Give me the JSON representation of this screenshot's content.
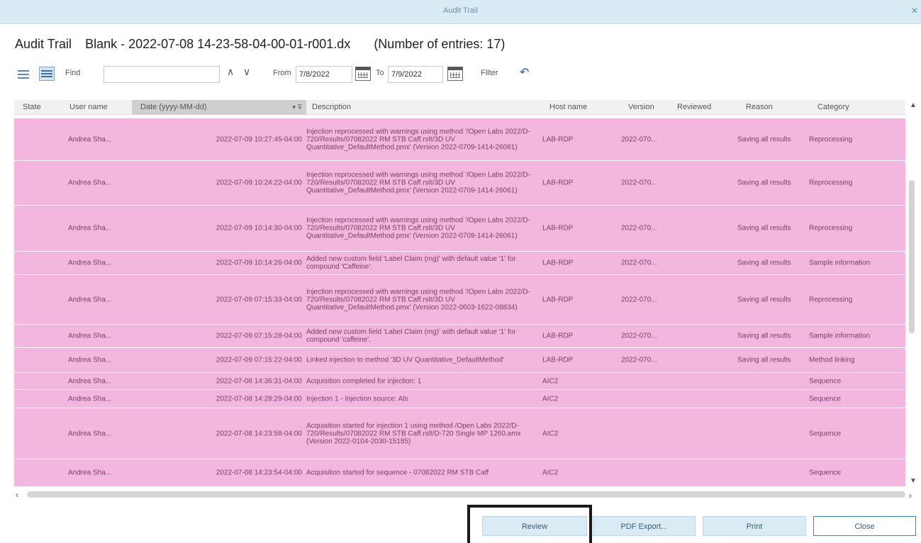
{
  "window": {
    "title": "Audit Trail",
    "close_icon": "close-icon"
  },
  "header": {
    "title": "Audit Trail",
    "filename": "Blank - 2022-07-08 14-23-58-04-00-01-r001.dx",
    "entries": "(Number of entries: 17)"
  },
  "toolbar": {
    "find_label": "Find",
    "find_value": "",
    "from_label": "From",
    "from_value": "7/8/2022",
    "to_label": "To",
    "to_value": "7/9/2022",
    "filter_label": "Filter"
  },
  "columns": [
    "State",
    "User name",
    "Date (yyyy-MM-dd)",
    "Description",
    "Host name",
    "Version",
    "Reviewed",
    "Reason",
    "Category"
  ],
  "rows": [
    {
      "user": "Andrea Sha...",
      "date": "2022-07-09 10:27:45-04:00",
      "desc": "Injection reprocessed with warnings using method '/Open Labs 2022/D-720/Results/07082022 RM STB Caff.rslt/3D UV Quantitative_DefaultMethod.pmx' (Version 2022-0709-1414-26061)",
      "host": "LAB-RDP",
      "version": "2022-070...",
      "reviewed": "",
      "reason": "Saving all results",
      "category": "Reprocessing"
    },
    {
      "user": "Andrea Sha...",
      "date": "2022-07-09 10:24:22-04:00",
      "desc": "Injection reprocessed with warnings using method '/Open Labs 2022/D-720/Results/07082022 RM STB Caff.rslt/3D UV Quantitative_DefaultMethod.pmx' (Version 2022-0709-1414-26061)",
      "host": "LAB-RDP",
      "version": "2022-070...",
      "reviewed": "",
      "reason": "Saving all results",
      "category": "Reprocessing"
    },
    {
      "user": "Andrea Sha...",
      "date": "2022-07-09 10:14:30-04:00",
      "desc": "Injection reprocessed with warnings using method '/Open Labs 2022/D-720/Results/07082022 RM STB Caff.rslt/3D UV Quantitative_DefaultMethod.pmx' (Version 2022-0709-1414-26061)",
      "host": "LAB-RDP",
      "version": "2022-070...",
      "reviewed": "",
      "reason": "Saving all results",
      "category": "Reprocessing"
    },
    {
      "user": "Andrea Sha...",
      "date": "2022-07-09 10:14:26-04:00",
      "desc": "Added new custom field 'Label Claim (mg)' with default value '1' for compound 'Caffeine'.",
      "host": "LAB-RDP",
      "version": "2022-070...",
      "reviewed": "",
      "reason": "Saving all results",
      "category": "Sample information"
    },
    {
      "user": "Andrea Sha...",
      "date": "2022-07-09 07:15:33-04:00",
      "desc": "Injection reprocessed with warnings using method '/Open Labs 2022/D-720/Results/07082022 RM STB Caff.rslt/3D UV Quantitative_DefaultMethod.pmx' (Version 2022-0603-1622-08834)",
      "host": "LAB-RDP",
      "version": "2022-070...",
      "reviewed": "",
      "reason": "Saving all results",
      "category": "Reprocessing"
    },
    {
      "user": "Andrea Sha...",
      "date": "2022-07-09 07:15:28-04:00",
      "desc": "Added new custom field 'Label Claim (mg)' with default value '1' for compound 'caffeine'.",
      "host": "LAB-RDP",
      "version": "2022-070...",
      "reviewed": "",
      "reason": "Saving all results",
      "category": "Sample information"
    },
    {
      "user": "Andrea Sha...",
      "date": "2022-07-09 07:15:22-04:00",
      "desc": "Linked injection to method '3D UV Quantitative_DefaultMethod'",
      "host": "LAB-RDP",
      "version": "2022-070...",
      "reviewed": "",
      "reason": "Saving all results",
      "category": "Method linking"
    },
    {
      "user": "Andrea Sha...",
      "date": "2022-07-08 14:36:31-04:00",
      "desc": "Acquisition completed for injection: 1",
      "host": "AIC2",
      "version": "",
      "reviewed": "",
      "reason": "",
      "category": "Sequence"
    },
    {
      "user": "Andrea Sha...",
      "date": "2022-07-08 14:28:29-04:00",
      "desc": "Injection 1 - Injection source: Als",
      "host": "AIC2",
      "version": "",
      "reviewed": "",
      "reason": "",
      "category": "Sequence"
    },
    {
      "user": "Andrea Sha...",
      "date": "2022-07-08 14:23:58-04:00",
      "desc": "Acquisition started for injection 1 using method /Open Labs 2022/D-720/Results/07082022 RM STB Caff.rslt/D-720 Single MP 1260.amx (Version 2022-0104-2030-15185)",
      "host": "AIC2",
      "version": "",
      "reviewed": "",
      "reason": "",
      "category": "Sequence"
    },
    {
      "user": "Andrea Sha...",
      "date": "2022-07-08 14:23:54-04:00",
      "desc": "Acquisition started for sequence - 07082022 RM STB Caff",
      "host": "AIC2",
      "version": "",
      "reviewed": "",
      "reason": "",
      "category": "Sequence"
    }
  ],
  "buttons": {
    "review": "Review",
    "pdf_export": "PDF Export...",
    "print": "Print",
    "close": "Close"
  }
}
